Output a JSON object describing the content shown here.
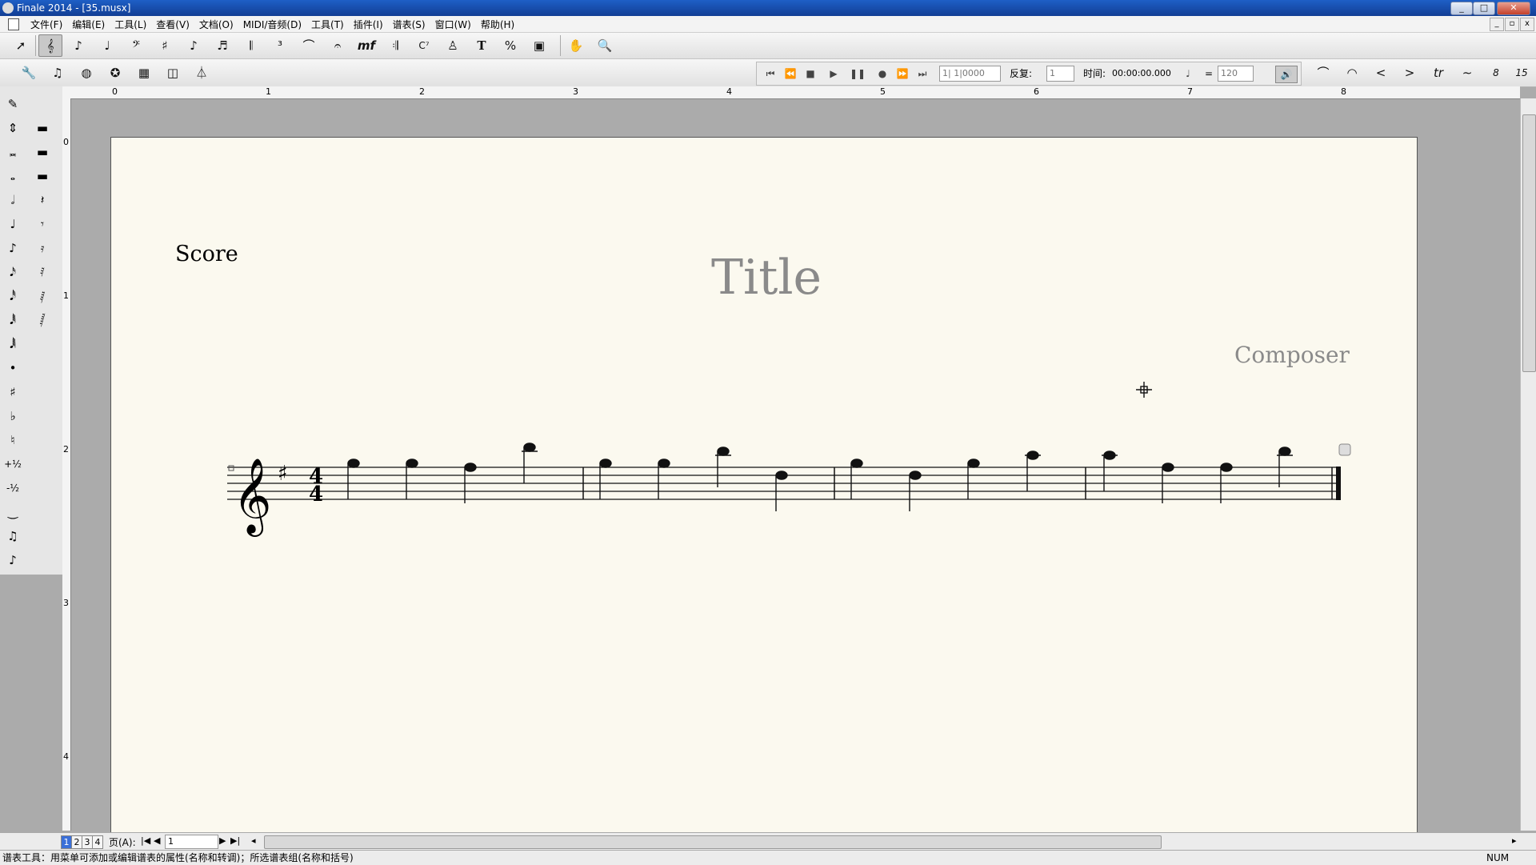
{
  "window": {
    "title": "Finale 2014 - [35.musx]"
  },
  "menu": [
    "文件(F)",
    "编辑(E)",
    "工具(L)",
    "查看(V)",
    "文档(O)",
    "MIDI/音频(D)",
    "工具(T)",
    "插件(I)",
    "谱表(S)",
    "窗口(W)",
    "帮助(H)"
  ],
  "playback": {
    "measure_value": "1| 1|0000",
    "repeat_label": "反复:",
    "repeat_value": "1",
    "time_label": "时间:",
    "time_value": "00:00:00.000",
    "tempo_equals": "=",
    "tempo_value": "120"
  },
  "ruler": {
    "ticks": [
      "0",
      "1",
      "2",
      "3",
      "4",
      "5",
      "6",
      "7",
      "8"
    ],
    "v_ticks": [
      "0",
      "1",
      "2",
      "3",
      "4"
    ]
  },
  "score": {
    "score_label": "Score",
    "title": "Title",
    "composer": "Composer",
    "key_signature": "G major (1 sharp)",
    "time_signature_top": "4",
    "time_signature_bottom": "4",
    "clef": "treble",
    "measures": 4
  },
  "navigation": {
    "pages": [
      "1",
      "2",
      "3",
      "4"
    ],
    "page_label": "页(A):",
    "page_value": "1"
  },
  "status": {
    "message": "谱表工具：用菜单可添加或编辑谱表的属性(名称和转调)；所选谱表组(名称和括号)",
    "indicator": "NUM"
  },
  "colors": {
    "titlebar": "#1a4fb0",
    "paper": "#fbf9ef",
    "desk": "#ababab"
  }
}
